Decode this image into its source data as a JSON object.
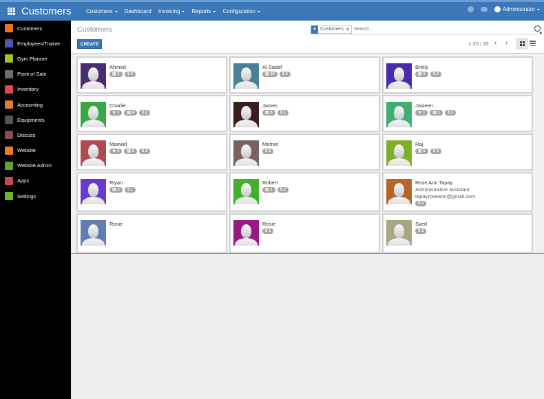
{
  "app": {
    "title": "Customers",
    "menu": [
      {
        "label": "Customers",
        "dropdown": true
      },
      {
        "label": "Dashboard",
        "dropdown": false
      },
      {
        "label": "Invoicing",
        "dropdown": true
      },
      {
        "label": "Reports",
        "dropdown": true
      },
      {
        "label": "Configuration",
        "dropdown": true
      }
    ],
    "user": "Administrator"
  },
  "sidebar": {
    "items": [
      {
        "label": "Customers",
        "icon": "chart-line-icon",
        "color": "#e8731f"
      },
      {
        "label": "Employees/Trainer",
        "icon": "users-icon",
        "color": "#4a5aa8"
      },
      {
        "label": "Gym Planner",
        "icon": "calendar-icon",
        "color": "#a4c12a"
      },
      {
        "label": "Point of Sale",
        "icon": "monitor-icon",
        "color": "#6d6d6d"
      },
      {
        "label": "Inventory",
        "icon": "box-icon",
        "color": "#e04a4a"
      },
      {
        "label": "Accounting",
        "icon": "calculator-icon",
        "color": "#e07b2a"
      },
      {
        "label": "Equipments",
        "icon": "hammer-icon",
        "color": "#555555"
      },
      {
        "label": "Discuss",
        "icon": "chat-icon",
        "color": "#8a4e4e"
      },
      {
        "label": "Website",
        "icon": "globe-icon",
        "color": "#f07b1f"
      },
      {
        "label": "Website Admin",
        "icon": "website-admin-icon",
        "color": "#5aa832"
      },
      {
        "label": "Apps",
        "icon": "apps-icon",
        "color": "#c94a4a"
      },
      {
        "label": "Settings",
        "icon": "gear-icon",
        "color": "#6ab82a"
      }
    ]
  },
  "control": {
    "breadcrumb": "Customers",
    "create_label": "CREATE",
    "search": {
      "facet": "Customers",
      "placeholder": "Search..."
    },
    "pager": "1-20 / 20"
  },
  "cards": [
    {
      "name": "Ahmed",
      "color": "#4a2d6e",
      "badges": [
        "▤ 1",
        "$ 4"
      ]
    },
    {
      "name": "Al Sadaf",
      "color": "#4a7f9a",
      "badges": [
        "▤ 10",
        "$ 1"
      ]
    },
    {
      "name": "Bretly",
      "color": "#4a2ab0",
      "badges": [
        "▤ 1",
        "$ 2"
      ]
    },
    {
      "name": "Charlie",
      "color": "#3aa845",
      "badges": [
        "★ 1",
        "▤ 4",
        "$ 2"
      ]
    },
    {
      "name": "James",
      "color": "#3a1e1c",
      "badges": [
        "▤ 3",
        "$ 1"
      ]
    },
    {
      "name": "Jasleen",
      "color": "#3fae74",
      "badges": [
        "★ 1",
        "▤ 1",
        "$ 2"
      ]
    },
    {
      "name": "Maxwel",
      "color": "#b04a4e",
      "badges": [
        "★ 1",
        "▤ 2",
        "$ 2"
      ]
    },
    {
      "name": "Mornie",
      "color": "#7a6260",
      "badges": [
        "$ 1"
      ]
    },
    {
      "name": "Raj",
      "color": "#7fb02a",
      "badges": [
        "▤ 5",
        "$ 1"
      ]
    },
    {
      "name": "Riyan",
      "color": "#6a3ad0",
      "badges": [
        "▤ 3",
        "$ 1"
      ]
    },
    {
      "name": "Robert",
      "color": "#42b02e",
      "badges": [
        "▤ 1",
        "$ 2"
      ]
    },
    {
      "name": "Rose Ann Tapay",
      "color": "#b8642a",
      "function": "Administrative assistant",
      "email": "tapayroseann@gmail.com",
      "badges": [
        "$ 1"
      ]
    },
    {
      "name": "Rosie",
      "color": "#5f7db0",
      "badges": []
    },
    {
      "name": "Rosie",
      "color": "#981a84",
      "badges": [
        "$ 1"
      ]
    },
    {
      "name": "Syed",
      "color": "#a8a880",
      "badges": [
        "$ 2"
      ]
    }
  ]
}
